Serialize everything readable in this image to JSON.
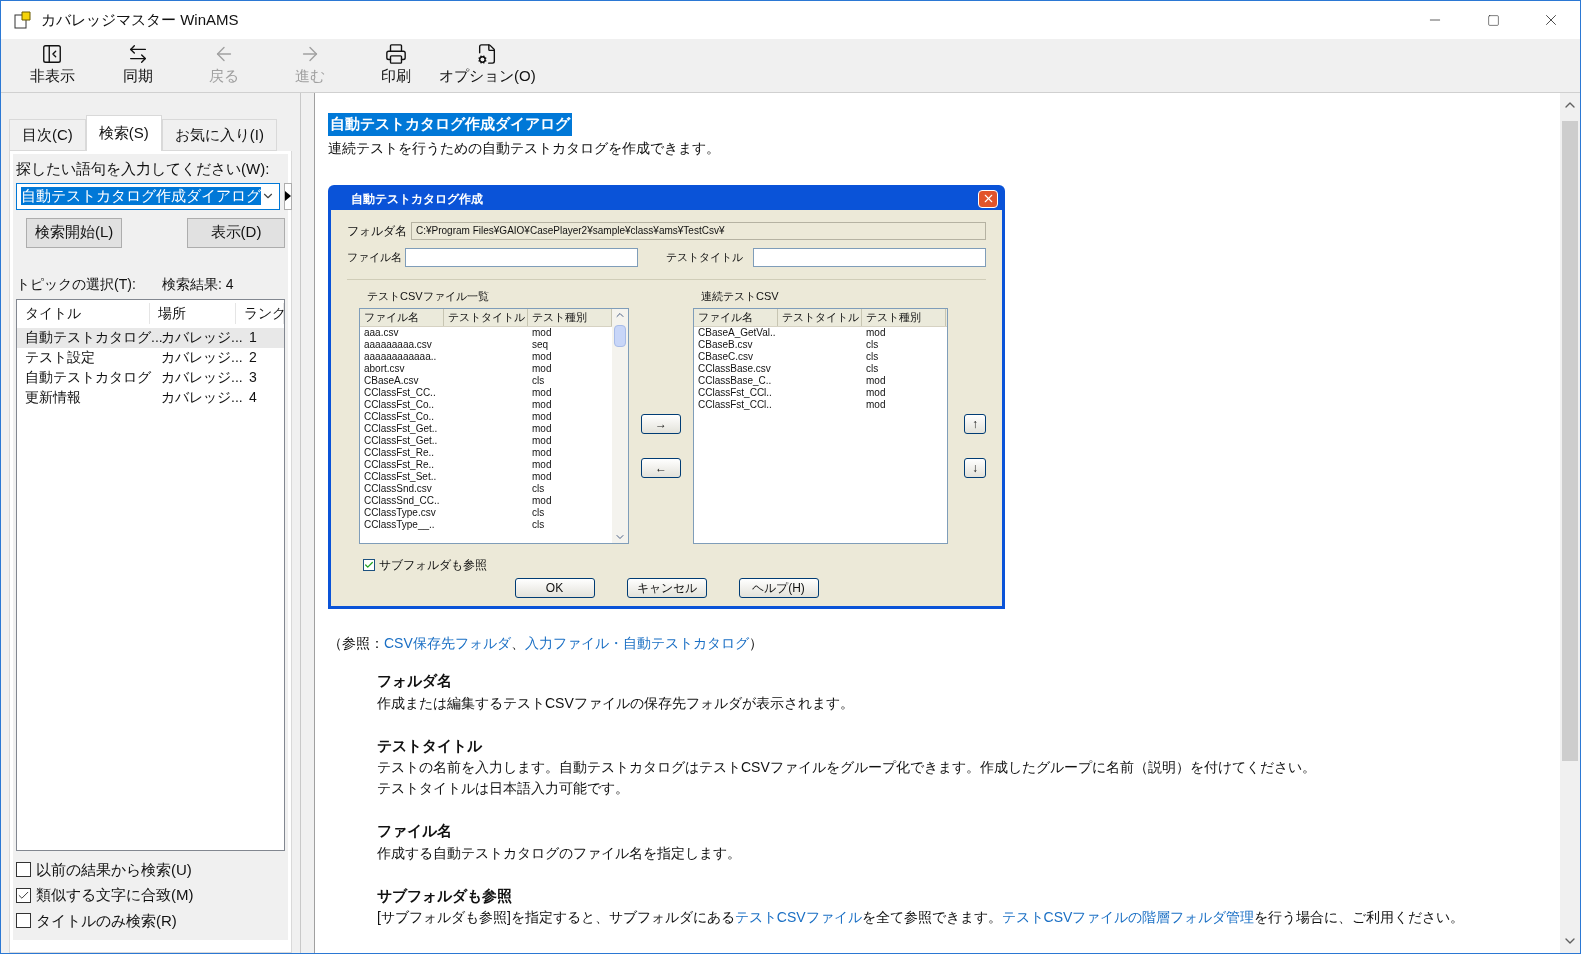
{
  "window": {
    "title": "カバレッジマスター WinAMS"
  },
  "toolbar": [
    {
      "label": "非表示",
      "disabled": false
    },
    {
      "label": "同期",
      "disabled": false
    },
    {
      "label": "戻る",
      "disabled": true
    },
    {
      "label": "進む",
      "disabled": true
    },
    {
      "label": "印刷",
      "disabled": false
    },
    {
      "label": "オプション(O)",
      "disabled": false
    }
  ],
  "tabs": [
    {
      "label": "目次(C)",
      "selected": false
    },
    {
      "label": "検索(S)",
      "selected": true
    },
    {
      "label": "お気に入り(I)",
      "selected": false
    }
  ],
  "search": {
    "label": "探したい語句を入力してください(W):",
    "value": "自動テストカタログ作成ダイアログ",
    "start_button": "検索開始(L)",
    "display_button": "表示(D)"
  },
  "topics": {
    "label": "トピックの選択(T):",
    "count": "検索結果: 4",
    "columns": [
      "タイトル",
      "場所",
      "ランク"
    ],
    "rows": [
      {
        "title": "自動テストカタログ...",
        "location": "カバレッジ...",
        "rank": "1",
        "selected": true
      },
      {
        "title": "テスト設定",
        "location": "カバレッジ...",
        "rank": "2",
        "selected": false
      },
      {
        "title": "自動テストカタログ",
        "location": "カバレッジ...",
        "rank": "3",
        "selected": false
      },
      {
        "title": "更新情報",
        "location": "カバレッジ...",
        "rank": "4",
        "selected": false
      }
    ]
  },
  "options": [
    {
      "label": "以前の結果から検索(U)",
      "checked": false
    },
    {
      "label": "類似する文字に合致(M)",
      "checked": true
    },
    {
      "label": "タイトルのみ検索(R)",
      "checked": false
    }
  ],
  "content": {
    "heading": "自動テストカタログ作成ダイアログ",
    "intro": "連続テストを行うための自動テストカタログを作成できます。",
    "dialog": {
      "title": "自動テストカタログ作成",
      "folder_label": "フォルダ名",
      "folder_value": "C:¥Program Files¥GAIO¥CasePlayer2¥sample¥class¥ams¥TestCsv¥",
      "file_label": "ファイル名",
      "test_title_label": "テストタイトル",
      "left_list": {
        "label": "テストCSVファイル一覧",
        "columns": [
          "ファイル名",
          "テストタイトル",
          "テスト種別"
        ],
        "rows": [
          [
            "aaa.csv",
            "mod"
          ],
          [
            "aaaaaaaaa.csv",
            "seq"
          ],
          [
            "aaaaaaaaaaaa..",
            "mod"
          ],
          [
            "abort.csv",
            "mod"
          ],
          [
            "CBaseA.csv",
            "cls"
          ],
          [
            "CClassFst_CC..",
            "mod"
          ],
          [
            "CClassFst_Co..",
            "mod"
          ],
          [
            "CClassFst_Co..",
            "mod"
          ],
          [
            "CClassFst_Get..",
            "mod"
          ],
          [
            "CClassFst_Get..",
            "mod"
          ],
          [
            "CClassFst_Re..",
            "mod"
          ],
          [
            "CClassFst_Re..",
            "mod"
          ],
          [
            "CClassFst_Set..",
            "mod"
          ],
          [
            "CClassSnd.csv",
            "cls"
          ],
          [
            "CClassSnd_CC..",
            "mod"
          ],
          [
            "CClassType.csv",
            "cls"
          ],
          [
            "CClassType__..",
            "cls"
          ]
        ]
      },
      "right_list": {
        "label": "連続テストCSV",
        "columns": [
          "ファイル名",
          "テストタイトル",
          "テスト種別"
        ],
        "rows": [
          [
            "CBaseA_GetVal..",
            "mod"
          ],
          [
            "CBaseB.csv",
            "cls"
          ],
          [
            "CBaseC.csv",
            "cls"
          ],
          [
            "CClassBase.csv",
            "cls"
          ],
          [
            "CClassBase_C..",
            "mod"
          ],
          [
            "CClassFst_CCl..",
            "mod"
          ],
          [
            "CClassFst_CCl..",
            "mod"
          ]
        ]
      },
      "add_button": "→",
      "remove_button": "←",
      "up_button": "↑",
      "down_button": "↓",
      "subfolder": {
        "label": "サブフォルダも参照",
        "checked": true
      },
      "buttons": [
        "OK",
        "キャンセル",
        "ヘルプ(H)"
      ]
    },
    "reference": [
      {
        "text": "（参照：",
        "link": false
      },
      {
        "text": "CSV保存先フォルダ",
        "link": true
      },
      {
        "text": "、",
        "link": false
      },
      {
        "text": "入力ファイル・自動テストカタログ",
        "link": true
      },
      {
        "text": "）",
        "link": false
      }
    ],
    "sections": [
      {
        "heading": "フォルダ名",
        "paragraphs": [
          [
            {
              "text": "作成または編集するテストCSVファイルの保存先フォルダが表示されます。",
              "link": false
            }
          ]
        ]
      },
      {
        "heading": "テストタイトル",
        "paragraphs": [
          [
            {
              "text": "テストの名前を入力します。自動テストカタログはテストCSVファイルをグループ化できます。作成したグループに名前（説明）を付けてください。",
              "link": false
            }
          ],
          [
            {
              "text": "テストタイトルは日本語入力可能です。",
              "link": false
            }
          ]
        ]
      },
      {
        "heading": "ファイル名",
        "paragraphs": [
          [
            {
              "text": "作成する自動テストカタログのファイル名を指定します。",
              "link": false
            }
          ]
        ]
      },
      {
        "heading": "サブフォルダも参照",
        "paragraphs": [
          [
            {
              "text": "[サブフォルダも参照]を指定すると、サブフォルダにある",
              "link": false
            },
            {
              "text": "テストCSVファイル",
              "link": true
            },
            {
              "text": "を全て参照できます。",
              "link": false
            },
            {
              "text": "テストCSVファイルの階層フォルダ管理",
              "link": true
            },
            {
              "text": "を行う場合に、ご利用ください。",
              "link": false
            }
          ]
        ]
      }
    ]
  }
}
